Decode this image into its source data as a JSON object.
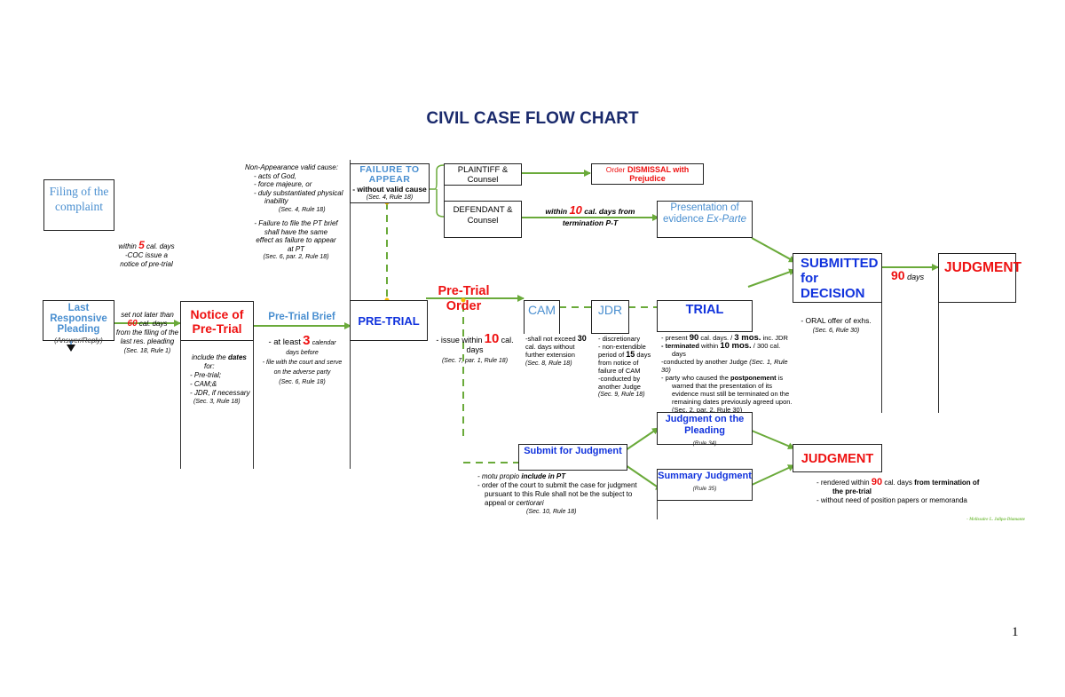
{
  "title": "CIVIL CASE FLOW CHART",
  "page_number": "1",
  "signature": "- Melissaire L. Jalipa-Diamante",
  "colors": {
    "arrow": "#6aaa3a",
    "dash": "#6aaa3a",
    "red": "#ee1111",
    "blue": "#1133dd",
    "light_blue": "#4a8fd0",
    "title": "#1a2a6c",
    "dot": "#f5b800"
  },
  "nodes": {
    "filing": {
      "label": "Filing of the complaint"
    },
    "last_pleading": {
      "label": "Last Responsive Pleading",
      "sub": "(Answer/Reply)"
    },
    "notice": {
      "label": "Notice of Pre-Trial"
    },
    "pretrial": {
      "label": "PRE-TRIAL"
    },
    "failure": {
      "label": "FAILURE TO APPEAR",
      "sub": "- without valid cause",
      "ref": "(Sec. 4, Rule 18)"
    },
    "plaintiff": {
      "label": "PLAINTIFF & Counsel"
    },
    "defendant": {
      "label": "DEFENDANT & Counsel"
    },
    "dismissal": {
      "prefix": "Order",
      "label": "DISMISSAL with Prejudice"
    },
    "ex_parte": {
      "label": "Presentation of evidence",
      "italic": "Ex-Parte"
    },
    "cam": {
      "label": "CAM"
    },
    "jdr": {
      "label": "JDR"
    },
    "trial": {
      "label": "TRIAL"
    },
    "submitted": {
      "label": "SUBMITTED for DECISION"
    },
    "judgment_top": {
      "label": "JUDGMENT"
    },
    "submit_judgment": {
      "label": "Submit for Judgment"
    },
    "judgment_pleading": {
      "label": "Judgment on the Pleading",
      "ref": "(Rule 34)"
    },
    "summary_judgment": {
      "label": "Summary Judgment",
      "ref": "(Rule 35)"
    },
    "judgment_bottom": {
      "label": "JUDGMENT"
    }
  },
  "labels": {
    "within5": {
      "pre": "within",
      "num": "5",
      "post": "cal. days",
      "line2": "-COC issue a",
      "line3": "notice of pre-trial"
    },
    "set_not_later": {
      "l1": "set not later than",
      "num": "60",
      "post": "cal. days",
      "l3": "from the filing of the",
      "l4": "last res. pleading",
      "ref": "(Sec. 18, Rule 1)"
    },
    "include_dates": {
      "l1": "include the",
      "l1b": "dates",
      "l2": "for:",
      "items": [
        "- Pre-trial;",
        "- CAM;&",
        "- JDR, if necessary"
      ],
      "ref": "(Sec. 3, Rule 18)"
    },
    "pretrial_brief": {
      "label": "Pre-Trial Brief",
      "pre": "- at least",
      "num": "3",
      "post": "calendar",
      "l2": "days before",
      "l3": "- file with the court and serve",
      "l4": "on the adverse party",
      "ref": "(Sec. 6, Rule 18)"
    },
    "non_appearance": {
      "head": "Non-Appearance valid cause:",
      "items": [
        "- acts of God,",
        "- force majeure, or",
        "- duly substantiated physical",
        "inability"
      ],
      "ref1": "(Sec. 4, Rule 18)",
      "p2": [
        "- Failure to file the PT brief",
        "shall have the same",
        "effect as failure to appear",
        "at PT"
      ],
      "ref2": "(Sec. 6, par. 2, Rule 18)"
    },
    "pretrial_order": {
      "label": "Pre-Trial Order",
      "pre": "- issue within",
      "num": "10",
      "post": "cal.",
      "l2": "days",
      "ref": "(Sec. 7, par. 1, Rule 18)"
    },
    "within10": {
      "pre": "within",
      "num": "10",
      "post": "cal. days from",
      "l2": "termination P-T"
    },
    "cam_note": {
      "pre": "-shall not exceed",
      "num": "30",
      "l2": "cal. days without",
      "l3": "further extension",
      "ref": "(Sec. 8, Rule 18)"
    },
    "jdr_note": {
      "items": [
        "- discretionary",
        "- non-extendible"
      ],
      "pre": "period of",
      "num": "15",
      "post": "days",
      "l4": "from notice of",
      "l5": "failure of CAM",
      "l6": "-conducted by",
      "l7": "another Judge",
      "ref": "(Sec. 9, Rule 18)"
    },
    "trial_note": {
      "l1_pre": "- present",
      "l1_num": "90",
      "l1_mid": "cal. days. /",
      "l1_num2": "3 mos.",
      "l1_post": "inc. JDR",
      "l2_b": "- terminated",
      "l2_mid": "within",
      "l2_num": "10 mos.",
      "l2_post": "/ 300 cal.",
      "l2b": "days",
      "l3": "-conducted by another Judge",
      "l3_ref": "(Sec. 1, Rule 30)",
      "l4_pre": "- party who caused the",
      "l4_b": "postponement",
      "l4_post": "is",
      "l4_rest": "warned that the presentation of its evidence must still be terminated on the remaining dates previously agreed upon.",
      "ref": "(Sec. 2, par. 2, Rule 30)"
    },
    "ninety_days": {
      "num": "90",
      "post": "days"
    },
    "oral_offer": {
      "l1": "- ORAL offer of exhs.",
      "ref": "(Sec. 6, Rule 30)"
    },
    "submit_note": {
      "l1_pre": "- motu propio",
      "l1_b": "include in PT",
      "l2": "- order of the court to submit the case for judgment",
      "l3": "pursuant to this Rule shall not be the subject to",
      "l4_pre": "appeal or",
      "l4_i": "certiorari",
      "ref": "(Sec. 10, Rule 18)"
    },
    "judgment_note": {
      "pre": "- rendered within",
      "num": "90",
      "mid": "cal. days",
      "b": "from termination of",
      "l2": "the pre-trial",
      "l3": "- without need of position papers or memoranda"
    }
  }
}
